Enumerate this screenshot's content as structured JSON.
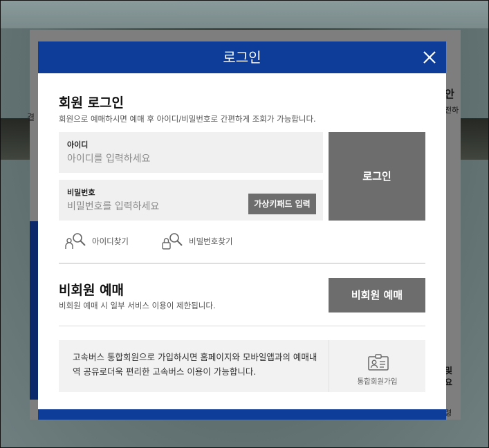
{
  "background": {
    "peek_left": "결",
    "peek_right_title": "안",
    "peek_right_sub": "전하",
    "peek_right_bold": "및 요",
    "peek_right_bottom": "령"
  },
  "modal": {
    "title": "로그인",
    "close_icon": "close-icon"
  },
  "member_login": {
    "title": "회원 로그인",
    "description": "회원으로 예매하시면 예매 후 아이디/비밀번호로 간편하게 조회가 가능합니다.",
    "id_label": "아이디",
    "id_placeholder": "아이디를 입력하세요",
    "id_value": "",
    "pw_label": "비밀번호",
    "pw_placeholder": "비밀번호를 입력하세요",
    "pw_value": "",
    "virtual_keypad_label": "가상키패드 입력",
    "login_button_label": "로그인",
    "find_id_label": "아이디찾기",
    "find_pw_label": "비밀번호찾기"
  },
  "guest": {
    "title": "비회원 예매",
    "description": "비회원 예매 시 일부 서비스 이용이 제한됩니다.",
    "button_label": "비회원 예매"
  },
  "membership": {
    "text": "고속버스 통합회원으로 가입하시면 홈페이지와 모바일앱과의 예매내역 공유로더욱 편리한 고속버스 이용이 가능합니다.",
    "join_label": "통합회원가입"
  },
  "colors": {
    "header_blue": "#0d3d99",
    "button_gray": "#6d6d6d",
    "field_bg": "#f0f0f0"
  }
}
